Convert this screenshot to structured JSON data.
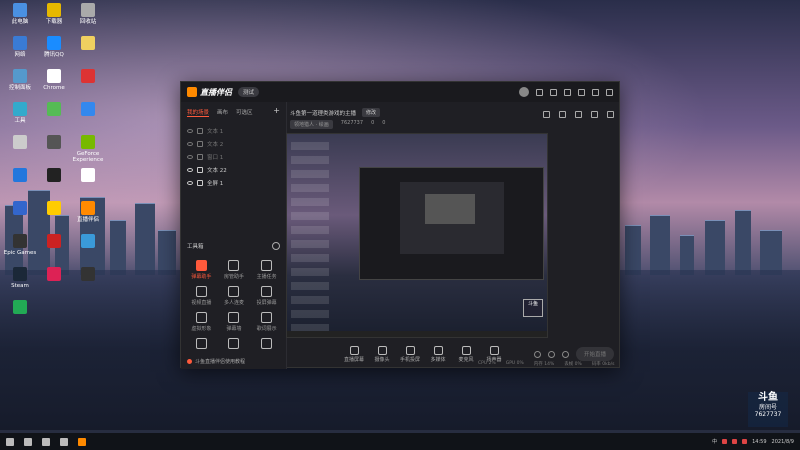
{
  "desktop_icons": [
    {
      "label": "此电脑",
      "color": "#4a90e2"
    },
    {
      "label": "下载器",
      "color": "#e6b800"
    },
    {
      "label": "回收站",
      "color": "#aaaaaa"
    },
    {
      "label": "网络",
      "color": "#3a7bd5"
    },
    {
      "label": "腾讯QQ",
      "color": "#1a8cff"
    },
    {
      "label": "",
      "color": "#f0d060"
    },
    {
      "label": "控制面板",
      "color": "#5599cc"
    },
    {
      "label": "Chrome",
      "color": "#ffffff"
    },
    {
      "label": "",
      "color": "#dd3333"
    },
    {
      "label": "工具",
      "color": "#33aacc"
    },
    {
      "label": "",
      "color": "#55bb55"
    },
    {
      "label": "",
      "color": "#3388ee"
    },
    {
      "label": "",
      "color": "#cccccc"
    },
    {
      "label": "",
      "color": "#555555"
    },
    {
      "label": "GeForce Experience",
      "color": "#77b900"
    },
    {
      "label": "",
      "color": "#2277dd"
    },
    {
      "label": "",
      "color": "#222222"
    },
    {
      "label": "",
      "color": "#ffffff"
    },
    {
      "label": "",
      "color": "#3366cc"
    },
    {
      "label": "",
      "color": "#ffcc00"
    },
    {
      "label": "直播伴侣",
      "color": "#ff8a00"
    },
    {
      "label": "Epic Games",
      "color": "#333333"
    },
    {
      "label": "",
      "color": "#cc2222"
    },
    {
      "label": "",
      "color": "#3a9ad9"
    },
    {
      "label": "Steam",
      "color": "#1b2838"
    },
    {
      "label": "",
      "color": "#dd2255"
    },
    {
      "label": "",
      "color": "#333333"
    },
    {
      "label": "",
      "color": "#22aa55"
    }
  ],
  "window": {
    "app_name": "直播伴侣",
    "version": "测试"
  },
  "left_panel": {
    "tabs": [
      "我的场景",
      "画布",
      "可选区"
    ],
    "add": "+",
    "scenes": [
      "文本 1",
      "文本 2",
      "窗口 1",
      "文本 22",
      "全屏 1"
    ],
    "tools_title": "工具箱",
    "tools": [
      "弹幕助手",
      "房管助手",
      "主播任务",
      "视频直播",
      "多人连麦",
      "投屏弹幕",
      "虚拟形象",
      "弹幕墙",
      "歌词展示",
      "",
      "",
      ""
    ],
    "footer": "斗鱼直播伴侣使用教程"
  },
  "main": {
    "room_title": "斗鱼第一道理类游戏的主播",
    "edit_label": "修改",
    "category": "领地猎人 · 绘画",
    "room_id": "7627737",
    "likes": "0",
    "watchers": "0",
    "bottom_tools": [
      "直播屏幕",
      "摄像头",
      "手机投屏",
      "多媒体",
      "麦克风",
      "扬声器"
    ],
    "start_button": "开始直播",
    "status_items": [
      "CPU 2%",
      "GPU 0%",
      "内存 14%",
      "丢帧 0%",
      "码率 0kb/s"
    ]
  },
  "preview_badge": "斗鱼",
  "room_badge": {
    "logo": "斗鱼",
    "label": "房间号",
    "number": "7627737"
  },
  "taskbar": {
    "time": "14:59",
    "date": "2021/8/9",
    "lang": "中"
  }
}
